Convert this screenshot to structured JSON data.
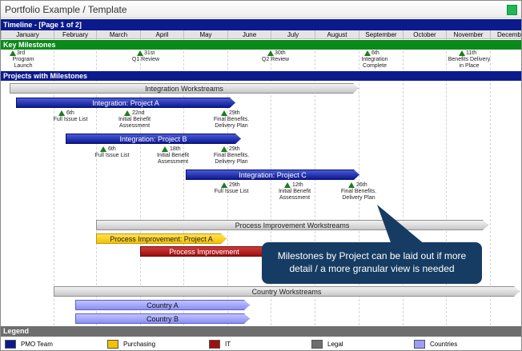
{
  "window": {
    "title": "Portfolio Example / Template"
  },
  "timeline": {
    "header": "Timeline - [Page 1 of 2]",
    "months": [
      "January",
      "February",
      "March",
      "April",
      "May",
      "June",
      "July",
      "August",
      "September",
      "October",
      "November",
      "December"
    ]
  },
  "key_milestones": {
    "header": "Key Milestones",
    "items": [
      {
        "date": "3rd",
        "label_lines": [
          "Program",
          "Launch"
        ]
      },
      {
        "date": "31st",
        "label_lines": [
          "Q1 Review"
        ]
      },
      {
        "date": "30th",
        "label_lines": [
          "Q2 Review"
        ]
      },
      {
        "date": "6th",
        "label_lines": [
          "Integration",
          "Complete"
        ]
      },
      {
        "date": "11th",
        "label_lines": [
          "Benefits Delivery",
          "in Place"
        ]
      }
    ]
  },
  "projects": {
    "header": "Projects with Milestones",
    "bars": {
      "integration_workstreams": "Integration Workstreams",
      "project_a": "Integration: Project A",
      "project_b": "Integration: Project B",
      "project_c": "Integration: Project C",
      "process_workstreams": "Process Improvement Workstreams",
      "process_a": "Process Improvement: Project A",
      "process_b": "Process Improvement",
      "country_workstreams": "Country Workstreams",
      "country_a": "Country A",
      "country_b": "Country B"
    },
    "project_a_milestones": [
      {
        "date": "6th",
        "label_lines": [
          "Full Issue List"
        ]
      },
      {
        "date": "22nd",
        "label_lines": [
          "Initial Benefit",
          "Assessment"
        ]
      },
      {
        "date": "29th",
        "label_lines": [
          "Final Benefits.",
          "Delivery Plan"
        ]
      }
    ],
    "project_b_milestones": [
      {
        "date": "6th",
        "label_lines": [
          "Full Issue List"
        ]
      },
      {
        "date": "18th",
        "label_lines": [
          "Initial Benefit",
          "Assessment"
        ]
      },
      {
        "date": "29th",
        "label_lines": [
          "Final Benefits.",
          "Delivery Plan"
        ]
      }
    ],
    "project_c_milestones": [
      {
        "date": "29th",
        "label_lines": [
          "Full Issue List"
        ]
      },
      {
        "date": "12th",
        "label_lines": [
          "Initial Benefit",
          "Assessment"
        ]
      },
      {
        "date": "26th",
        "label_lines": [
          "Final Benefits.",
          "Delivery Plan"
        ]
      }
    ]
  },
  "callout": {
    "line1": "Milestones by Project can be laid out if more",
    "line2": "detail / a more granular view is needed"
  },
  "legend": {
    "header": "Legend",
    "items": [
      {
        "label": "PMO Team",
        "color": "#0b1a8c"
      },
      {
        "label": "Purchasing",
        "color": "#f5c100"
      },
      {
        "label": "IT",
        "color": "#a01010"
      },
      {
        "label": "Legal",
        "color": "#6e6e6e"
      },
      {
        "label": "Countries",
        "color": "#9a9ef5"
      }
    ]
  },
  "colors": {
    "band_blue": "#0b1a8c",
    "band_green": "#0a8a1a",
    "milestone_green": "#1f7a1f",
    "callout": "#163c63",
    "status_square": "#1db954"
  }
}
